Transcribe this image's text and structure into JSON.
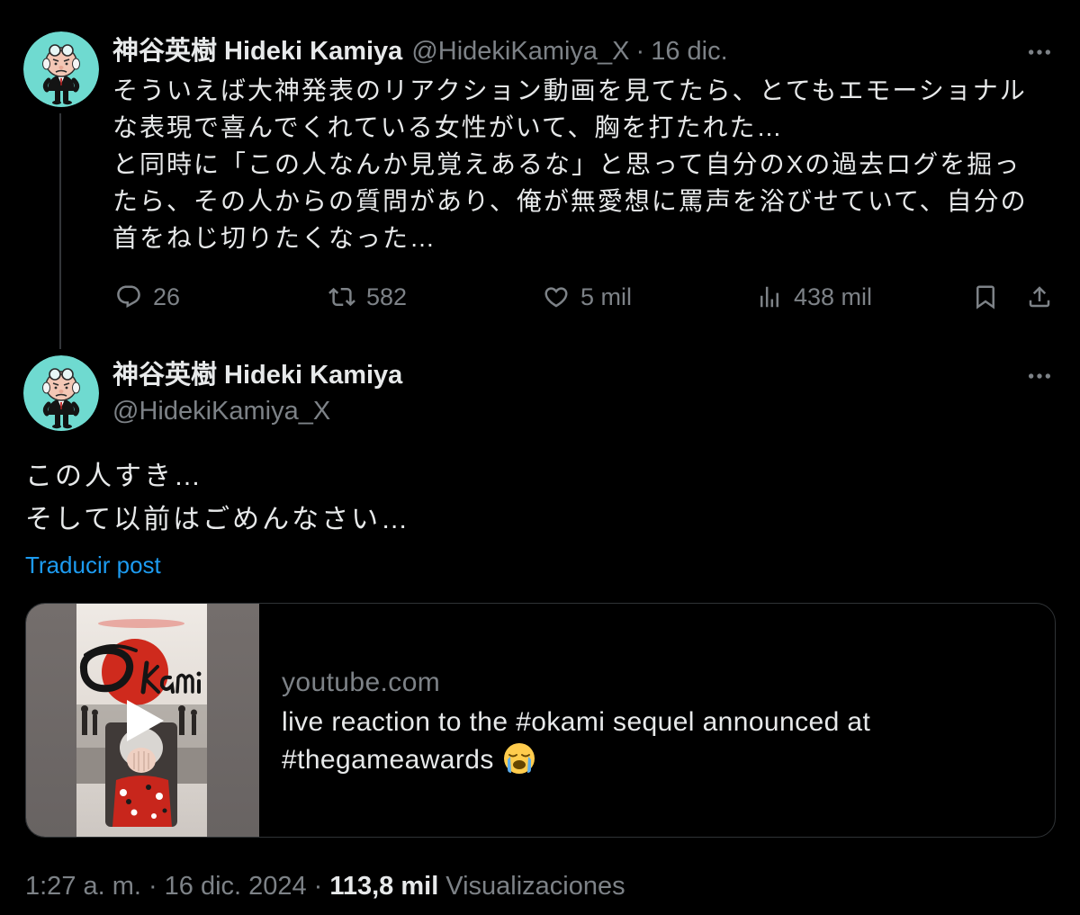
{
  "colors": {
    "background": "#000000",
    "text_primary": "#e7e9ea",
    "text_secondary": "#7d8287",
    "link": "#1d9bf0",
    "border": "#2f3336",
    "thread_line": "#333639",
    "avatar_background": "#6fdad0"
  },
  "thread_post": {
    "display_name": "神谷英樹 Hideki Kamiya",
    "handle": "@HidekiKamiya_X",
    "separator": "·",
    "date": "16 dic.",
    "more_icon": "more-icon",
    "text_lines": [
      "そういえば大神発表のリアクション動画を見てたら、とてもエモーショナル",
      "な表現で喜んでくれている女性がいて、胸を打たれた…",
      "と同時に「この人なんか見覚えあるな」と思って自分のXの過去ログを掘っ",
      "たら、その人からの質問があり、俺が無愛想に罵声を浴びせていて、自分の",
      "首をねじ切りたくなった…"
    ],
    "stats": {
      "replies": {
        "icon": "reply-icon",
        "value": "26"
      },
      "reposts": {
        "icon": "repost-icon",
        "value": "582"
      },
      "likes": {
        "icon": "heart-icon",
        "value": "5 mil"
      },
      "views": {
        "icon": "views-icon",
        "value": "438 mil"
      },
      "bookmark": {
        "icon": "bookmark-icon"
      },
      "share": {
        "icon": "share-icon"
      }
    }
  },
  "main_post": {
    "display_name": "神谷英樹 Hideki Kamiya",
    "handle": "@HidekiKamiya_X",
    "more_icon": "more-icon",
    "text_lines": [
      "この人すき…",
      "そして以前はごめんなさい…"
    ],
    "translate_link": "Traducir post",
    "link_card": {
      "domain": "youtube.com",
      "title_lines": [
        "live reaction to the #okami sequel announced at",
        "#thegameawards"
      ],
      "title_emoji_icon": "loudly-crying-face-icon",
      "thumbnail_icon": "video-play-icon"
    },
    "meta": {
      "time": "1:27 a. m.",
      "separator": "·",
      "date": "16 dic. 2024",
      "views_count": "113,8 mil",
      "views_label": "Visualizaciones"
    }
  }
}
